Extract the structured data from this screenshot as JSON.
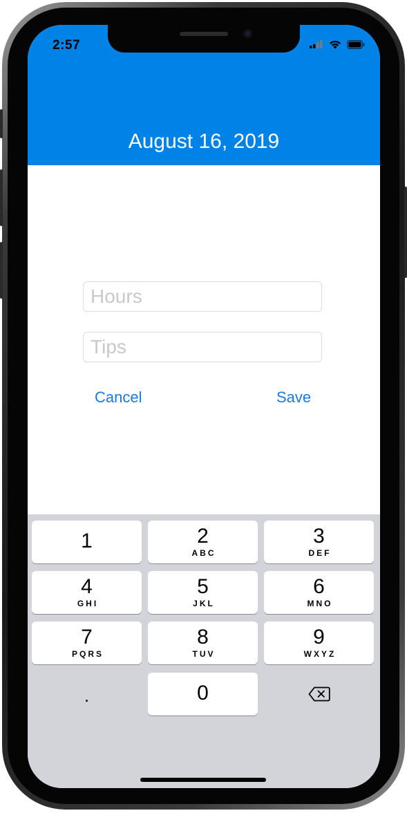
{
  "status_bar": {
    "time": "2:57"
  },
  "header": {
    "title": "August 16, 2019"
  },
  "form": {
    "hours_placeholder": "Hours",
    "tips_placeholder": "Tips",
    "cancel_label": "Cancel",
    "save_label": "Save"
  },
  "keypad": {
    "keys": [
      {
        "num": "1",
        "letters": ""
      },
      {
        "num": "2",
        "letters": "ABC"
      },
      {
        "num": "3",
        "letters": "DEF"
      },
      {
        "num": "4",
        "letters": "GHI"
      },
      {
        "num": "5",
        "letters": "JKL"
      },
      {
        "num": "6",
        "letters": "MNO"
      },
      {
        "num": "7",
        "letters": "PQRS"
      },
      {
        "num": "8",
        "letters": "TUV"
      },
      {
        "num": "9",
        "letters": "WXYZ"
      },
      {
        "num": "0",
        "letters": ""
      }
    ],
    "decimal": ".",
    "delete_icon": "delete-backspace-icon"
  },
  "colors": {
    "header_bg": "#0082e6",
    "link": "#1a7ae0",
    "keyboard_bg": "#d2d4da"
  }
}
